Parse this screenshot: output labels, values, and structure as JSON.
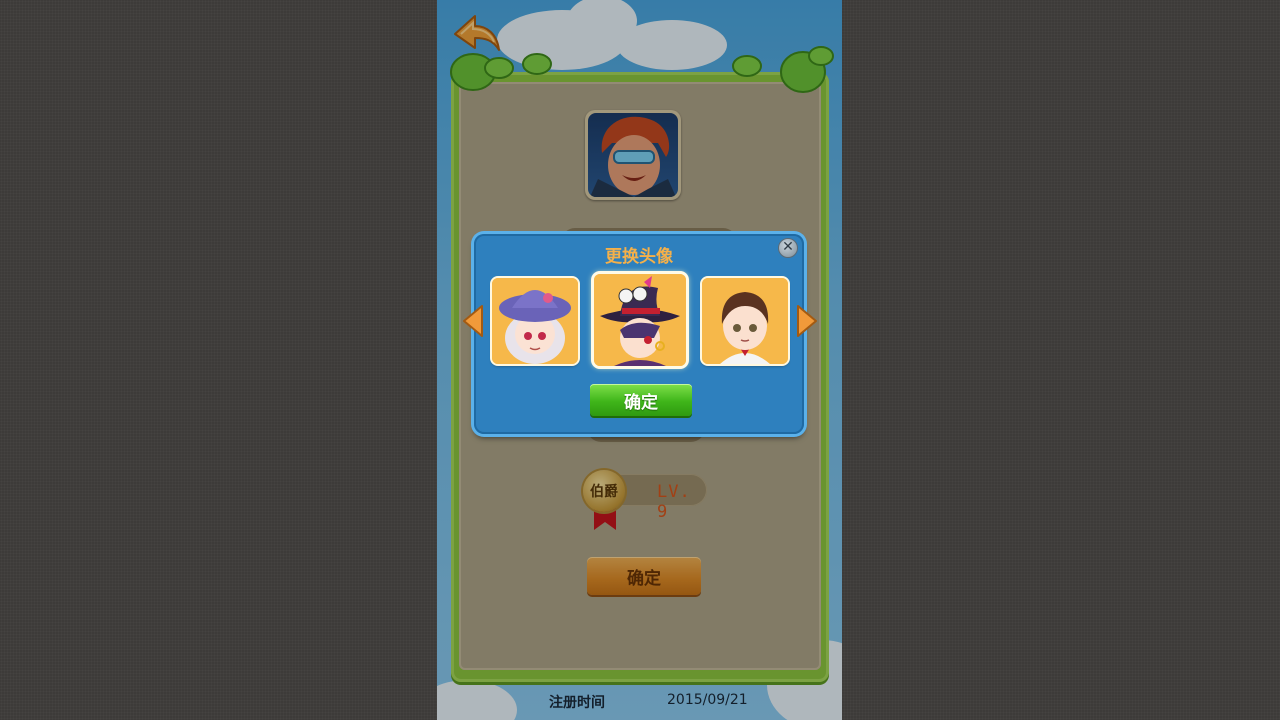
{
  "screen": {
    "back_icon": "back-arrow-icon",
    "profile": {
      "level": "LV. 9",
      "rank": "伯爵",
      "confirm_label": "确定",
      "register_label": "注册时间",
      "register_date": "2015/09/21"
    }
  },
  "dialog": {
    "title": "更换头像",
    "close_icon": "close-icon",
    "prev_icon": "arrow-left-icon",
    "next_icon": "arrow-right-icon",
    "avatars": [
      {
        "name": "witch-girl-avatar",
        "selected": false
      },
      {
        "name": "magician-boy-avatar",
        "selected": true
      },
      {
        "name": "gentleman-avatar",
        "selected": false
      }
    ],
    "confirm_label": "确定"
  },
  "colors": {
    "sky": "#4aa6e0",
    "panel_green": "#8cc63f",
    "panel_inner": "#aea488",
    "dialog_blue": "#2e80be",
    "title_orange": "#f4b04a",
    "confirm_green": "#3fb51a",
    "confirm_orange": "#dd8a26",
    "level_text": "#d8561c"
  }
}
